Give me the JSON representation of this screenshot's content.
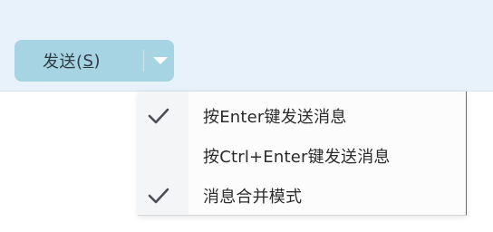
{
  "composer": {
    "send_button": {
      "label_prefix": "发送(",
      "access_key": "S",
      "label_suffix": ")"
    }
  },
  "send_menu": {
    "items": [
      {
        "label": "按Enter键发送消息",
        "checked": true
      },
      {
        "label": "按Ctrl+Enter键发送消息",
        "checked": false
      },
      {
        "label": "消息合并模式",
        "checked": true
      }
    ]
  },
  "icons": {
    "dropdown": "chevron-down-icon",
    "check": "check-icon"
  },
  "colors": {
    "composer_background": "#e7f2fb",
    "send_button_background": "#a7d4e2",
    "menu_background": "#fcfcfc",
    "check_color": "#4a4f56"
  }
}
